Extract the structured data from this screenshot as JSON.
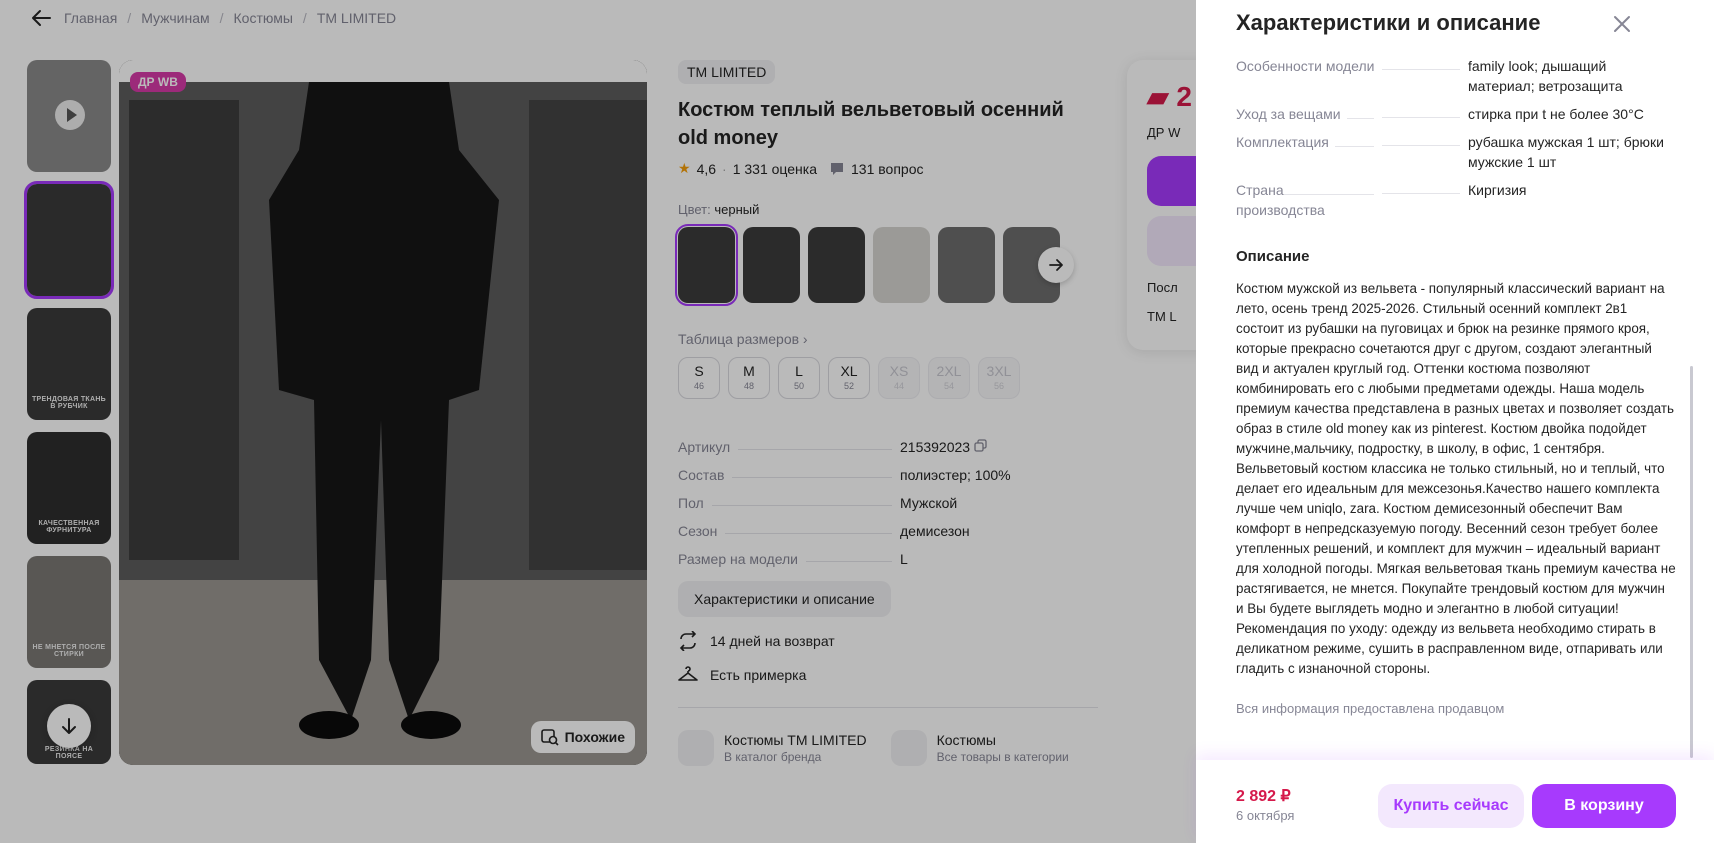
{
  "breadcrumb": {
    "items": [
      "Главная",
      "Мужчинам",
      "Костюмы",
      "TM LIMITED"
    ]
  },
  "thumbnails": {
    "captions": [
      "",
      "",
      "ТРЕНДОВАЯ ТКАНЬ В РУБЧИК",
      "КАЧЕСТВЕННАЯ ФУРНИТУРА",
      "НЕ МНЕТСЯ ПОСЛЕ СТИРКИ",
      "РЕЗИНКА НА ПОЯСЕ"
    ]
  },
  "photo": {
    "badge": "ДР WB",
    "similar_label": "Похожие"
  },
  "product": {
    "brand": "TM LIMITED",
    "title": "Костюм теплый вельветовый осенний old money",
    "rating": "4,6",
    "reviews": "1 331 оценка",
    "questions": "131 вопрос",
    "color_label": "Цвет:",
    "color_value": "черный",
    "size_table_link": "Таблица размеров",
    "sizes": [
      {
        "label": "S",
        "num": "46",
        "available": true
      },
      {
        "label": "M",
        "num": "48",
        "available": true
      },
      {
        "label": "L",
        "num": "50",
        "available": true
      },
      {
        "label": "XL",
        "num": "52",
        "available": true
      },
      {
        "label": "XS",
        "num": "44",
        "available": false
      },
      {
        "label": "2XL",
        "num": "54",
        "available": false
      },
      {
        "label": "3XL",
        "num": "56",
        "available": false
      }
    ],
    "specs": [
      {
        "key": "Артикул",
        "value": "215392023"
      },
      {
        "key": "Состав",
        "value": "полиэстер; 100%"
      },
      {
        "key": "Пол",
        "value": "Мужской"
      },
      {
        "key": "Сезон",
        "value": "демисезон"
      },
      {
        "key": "Размер на модели",
        "value": "L"
      }
    ],
    "chars_button": "Характеристики и описание",
    "perks": [
      "14 дней на возврат",
      "Есть примерка"
    ],
    "links": [
      {
        "title": "Костюмы TM LIMITED",
        "sub": "В каталог бренда"
      },
      {
        "title": "Костюмы",
        "sub": "Все товары в категории"
      }
    ]
  },
  "buy_card": {
    "price_partial": "2",
    "tag_partial": "ДР W",
    "row1_partial": "Посл",
    "row2_partial": "TM L"
  },
  "drawer": {
    "title": "Характеристики и описание",
    "specs": [
      {
        "key": "Особенности модели",
        "value": "family look; дышащий материал; ветрозащита"
      },
      {
        "key": "Уход за вещами",
        "value": "стирка при t не более 30°C"
      },
      {
        "key": "Комплектация",
        "value": "рубашка мужская 1 шт; брюки мужские 1 шт"
      },
      {
        "key": "Страна производства",
        "value": "Киргизия"
      }
    ],
    "description_heading": "Описание",
    "description": "Костюм мужской из вельвета - популярный классический вариант на лето, осень тренд 2025-2026. Стильный осенний комплект 2в1 состоит из рубашки на пуговицах и брюк на резинке прямого кроя, которые прекрасно сочетаются друг с другом, создают элегантный вид и актуален круглый год. Оттенки костюма позволяют комбинировать его с любыми предметами одежды. Наша модель премиум качества представлена в разных цветах и позволяет создать образ в стиле old money как из pinterest. Костюм двойка подойдет мужчине,мальчику, подростку, в школу, в офис, 1 сентября. Вельветовый костюм классика не только стильный, но и теплый, что делает его идеальным для межсезонья.Качество нашего комплекта лучше чем uniqlo, zara. Костюм демисезонный обеспечит Вам комфорт в непредсказуемую погоду. Весенний сезон требует более утепленных решений, и комплект для мужчин – идеальный вариант для холодной погоды. Мягкая вельветовая ткань премиум качества не растягивается, не мнется. Покупайте трендовый костюм для мужчин и Вы будете выглядеть модно и элегантно в любой ситуации!\nРекомендация по уходу: одежду из вельвета необходимо стирать в деликатном режиме, сушить в расправленном виде, отпаривать или гладить с изнаночной стороны.",
    "provided_by": "Вся информация предоставлена продавцом",
    "footer": {
      "price": "2 892 ₽",
      "delivery_date": "6 октября",
      "buy_now": "Купить сейчас",
      "add_to_cart": "В корзину"
    }
  },
  "colors": {
    "accent": "#a73afd",
    "price": "#d5194a",
    "badge": "#d63aa8"
  }
}
